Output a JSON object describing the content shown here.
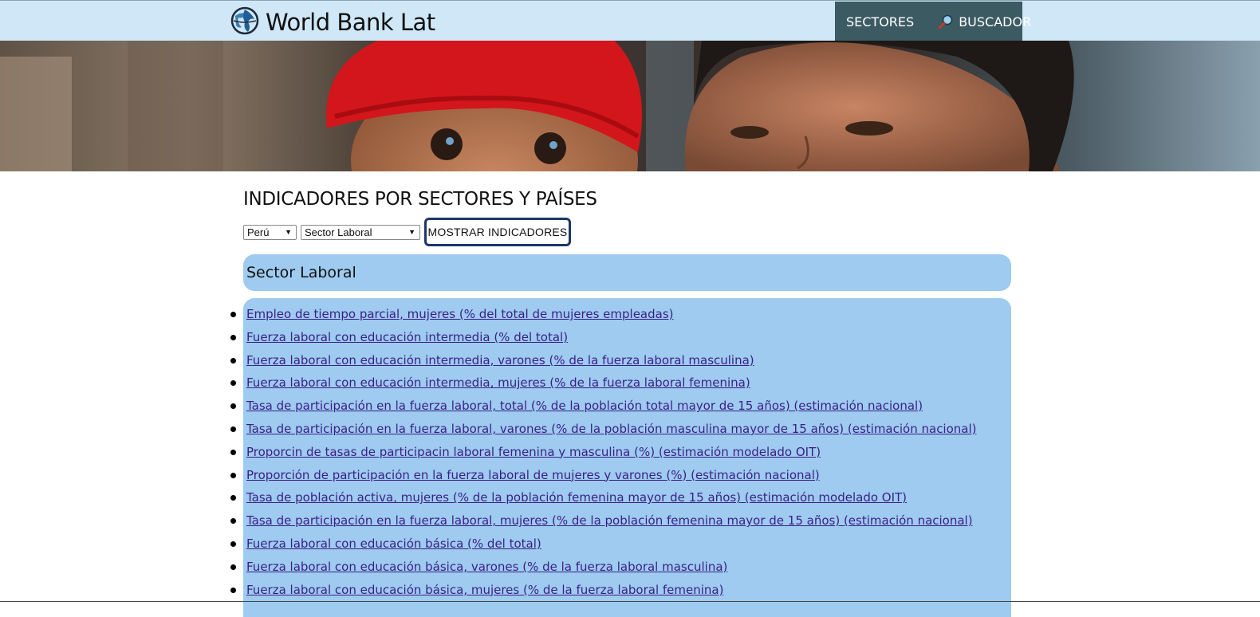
{
  "header": {
    "logo_text": "World Bank Lat",
    "nav": {
      "sectores_label": "SECTORES",
      "buscador_label": "BUSCADOR"
    }
  },
  "main": {
    "title": "INDICADORES POR SECTORES Y PAÍSES",
    "country_select": {
      "selected": "Perú"
    },
    "sector_select": {
      "selected": "Sector Laboral"
    },
    "show_button": "MOSTRAR INDICADORES",
    "sector_heading": "Sector Laboral",
    "indicators": [
      "Empleo de tiempo parcial, mujeres (% del total de mujeres empleadas)",
      "Fuerza laboral con educación intermedia (% del total)",
      "Fuerza laboral con educación intermedia, varones (% de la fuerza laboral masculina)",
      "Fuerza laboral con educación intermedia, mujeres (% de la fuerza laboral femenina)",
      "Tasa de participación en la fuerza laboral, total (% de la población total mayor de 15 años) (estimación nacional)",
      "Tasa de participación en la fuerza laboral, varones (% de la población masculina mayor de 15 años) (estimación nacional)",
      "Proporcin de tasas de participacin laboral femenina y masculina (%) (estimación modelado OIT)",
      "Proporción de participación en la fuerza laboral de mujeres y varones (%) (estimación nacional)",
      "Tasa de población activa, mujeres (% de la población femenina mayor de 15 años) (estimación modelado OIT)",
      "Tasa de participación en la fuerza laboral, mujeres (% de la población femenina mayor de 15 años) (estimación nacional)",
      "Fuerza laboral con educación básica (% del total)",
      "Fuerza laboral con educación básica, varones (% de la fuerza laboral masculina)",
      "Fuerza laboral con educación básica, mujeres (% de la fuerza laboral femenina)"
    ]
  },
  "colors": {
    "topbar_bg": "#cfe7f7",
    "nav_bg": "#3c5a62",
    "panel_bg": "#9ecbef",
    "link": "#3a1f87",
    "button_border": "#1c3766"
  },
  "icons": {
    "logo": "globe-icon",
    "buscador": "magnifier-icon",
    "select_arrow": "triangle-down-icon"
  }
}
